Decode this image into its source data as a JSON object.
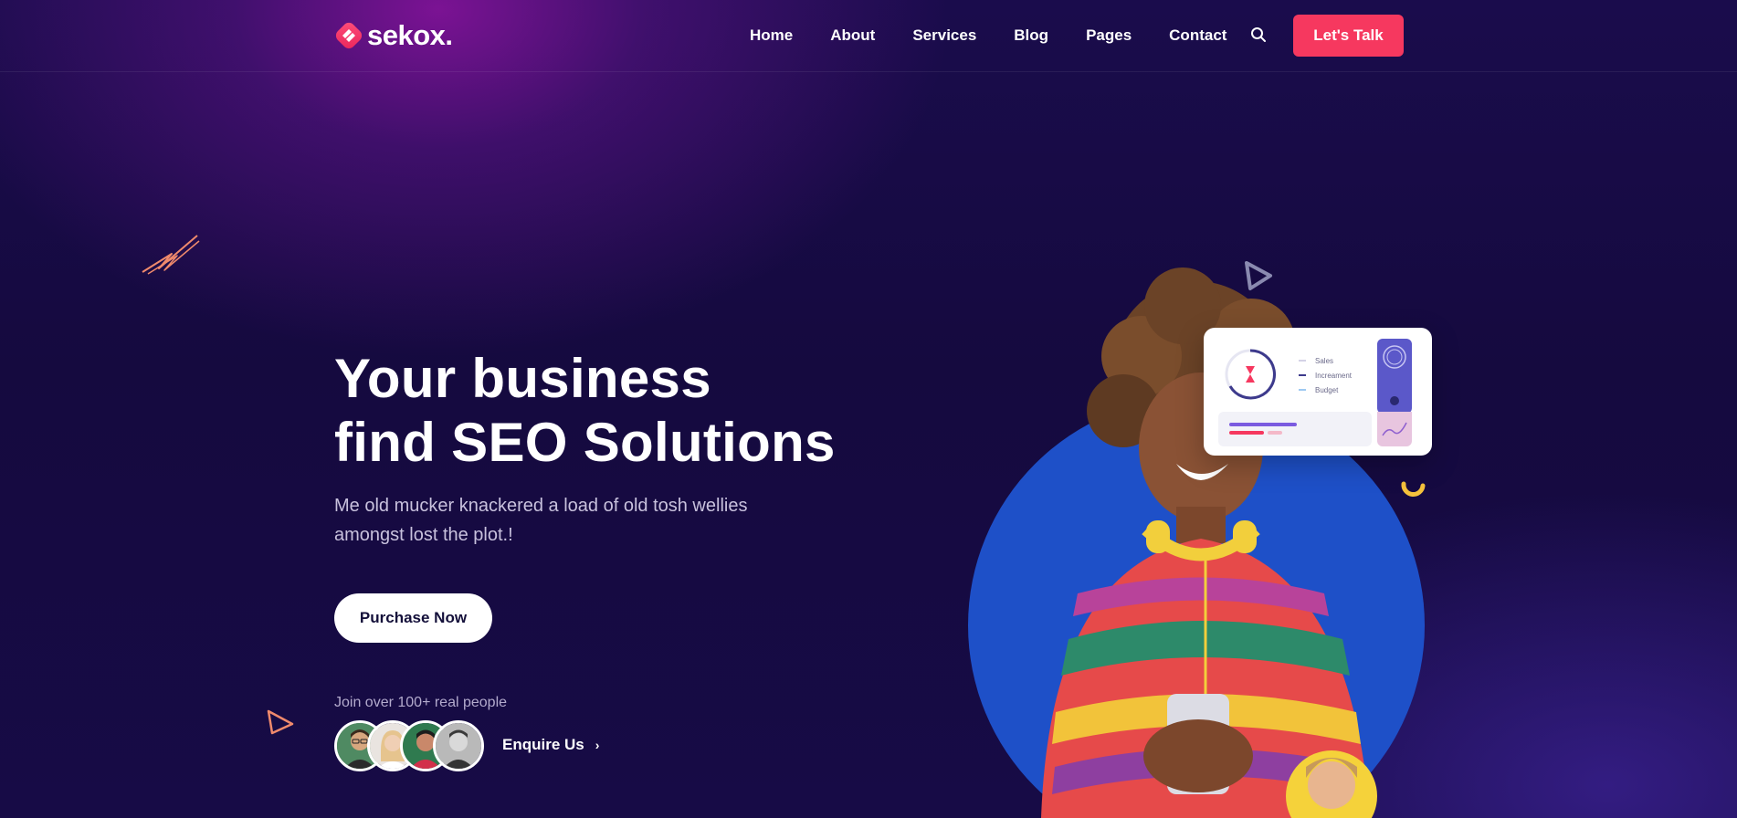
{
  "brand": {
    "name": "sekox."
  },
  "nav": {
    "items": [
      {
        "label": "Home"
      },
      {
        "label": "About"
      },
      {
        "label": "Services"
      },
      {
        "label": "Blog"
      },
      {
        "label": "Pages"
      },
      {
        "label": "Contact"
      }
    ],
    "cta_label": "Let's Talk"
  },
  "hero": {
    "title_line1": "Your business",
    "title_line2": "find SEO Solutions",
    "description": "Me old mucker knackered a load of old tosh wellies amongst lost the plot.!",
    "primary_button": "Purchase Now",
    "join_text": "Join over 100+ real people",
    "enquire_label": "Enquire Us"
  },
  "dashboard_card": {
    "legend": [
      {
        "label": "Sales",
        "color": "#d4d2e6"
      },
      {
        "label": "Increament",
        "color": "#3d3a8c"
      },
      {
        "label": "Budget",
        "color": "#9ec9f2"
      }
    ]
  },
  "colors": {
    "accent": "#f6385f",
    "background": "#150a3f",
    "circle_blue": "#1e50c8",
    "deco_orange": "#f08a6c",
    "deco_yellow": "#f5c23c"
  },
  "icons": {
    "search": "search-icon",
    "enquire_arrow": "chevron-right-icon",
    "logo": "logo-mark-icon"
  }
}
